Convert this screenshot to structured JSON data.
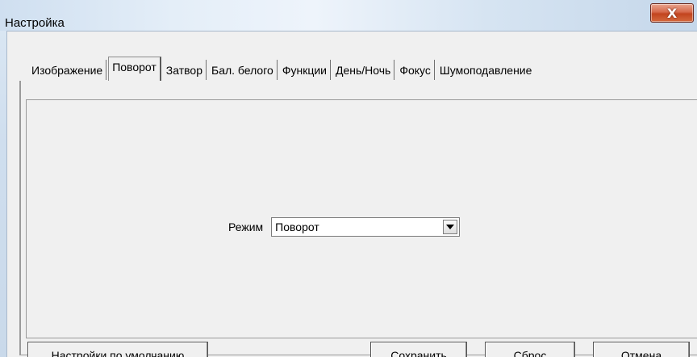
{
  "window": {
    "title": "Настройка",
    "close_label": "X"
  },
  "tabs": [
    {
      "label": "Изображение",
      "active": false
    },
    {
      "label": "Поворот",
      "active": true
    },
    {
      "label": "Затвор",
      "active": false
    },
    {
      "label": "Бал. белого",
      "active": false
    },
    {
      "label": "Функции",
      "active": false
    },
    {
      "label": "День/Ночь",
      "active": false
    },
    {
      "label": "Фокус",
      "active": false
    },
    {
      "label": "Шумоподавление",
      "active": false
    }
  ],
  "panel": {
    "mode_label": "Режим",
    "mode_value": "Поворот"
  },
  "buttons": {
    "defaults": "Настройки по умолчанию",
    "save": "Сохранить",
    "reset": "Сброс",
    "cancel": "Отмена"
  },
  "colors": {
    "close_button": "#c2441f",
    "titlebar": "#dce8f4",
    "client_bg": "#f0f0f0"
  }
}
